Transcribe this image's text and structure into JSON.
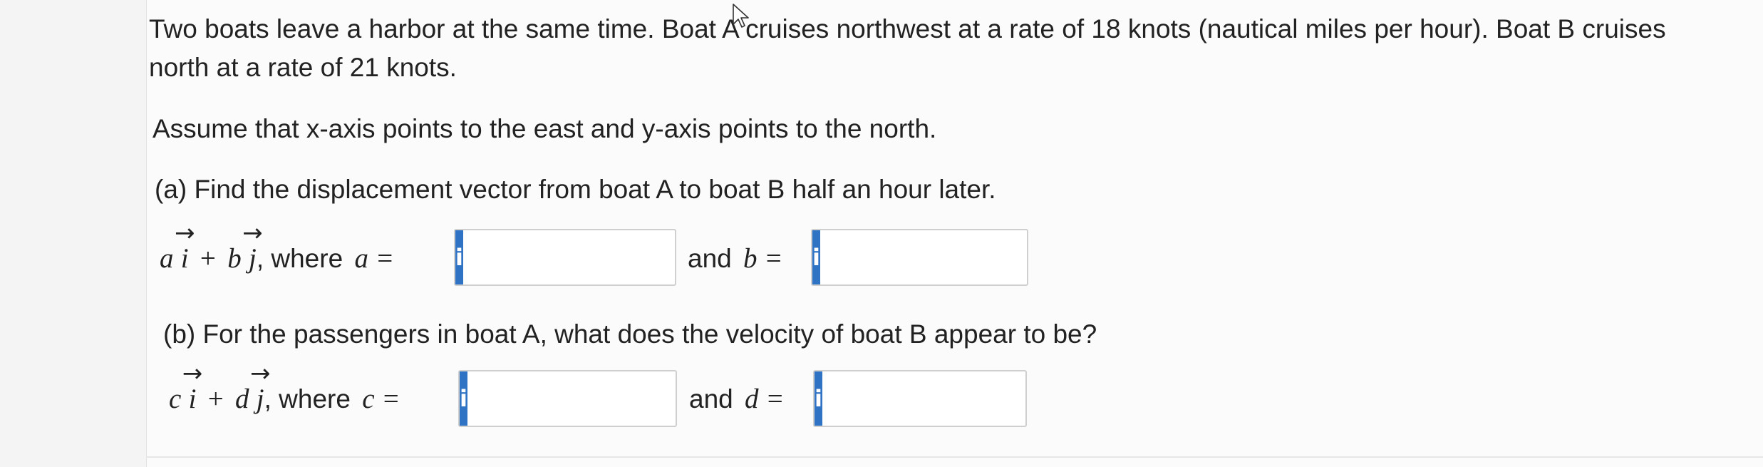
{
  "problem": {
    "line1": "Two boats leave a harbor at the same time. Boat A cruises northwest at a rate of 18 knots (nautical miles per hour). Boat B cruises",
    "line2": "north at a rate of 21 knots.",
    "assumption": "Assume that x-axis points to the east and y-axis points to the north."
  },
  "part_a": {
    "prompt": "(a) Find the displacement vector from boat A to boat B half an hour later.",
    "var1": "a",
    "unit1": "i",
    "plus": "+",
    "var2": "b",
    "unit2": "j",
    "where": ", where",
    "lhs1": "a =",
    "and_label": "and",
    "lhs2": "b =",
    "input_a": "",
    "input_b": ""
  },
  "part_b": {
    "prompt": "(b) For the passengers in boat A, what does the velocity of boat B appear to be?",
    "var1": "c",
    "unit1": "i",
    "plus": "+",
    "var2": "d",
    "unit2": "j",
    "where": ", where",
    "lhs1": "c =",
    "and_label": "and",
    "lhs2": "d =",
    "input_c": "",
    "input_d": ""
  },
  "icons": {
    "info_glyph": "i",
    "info_color": "#2f73c4"
  }
}
